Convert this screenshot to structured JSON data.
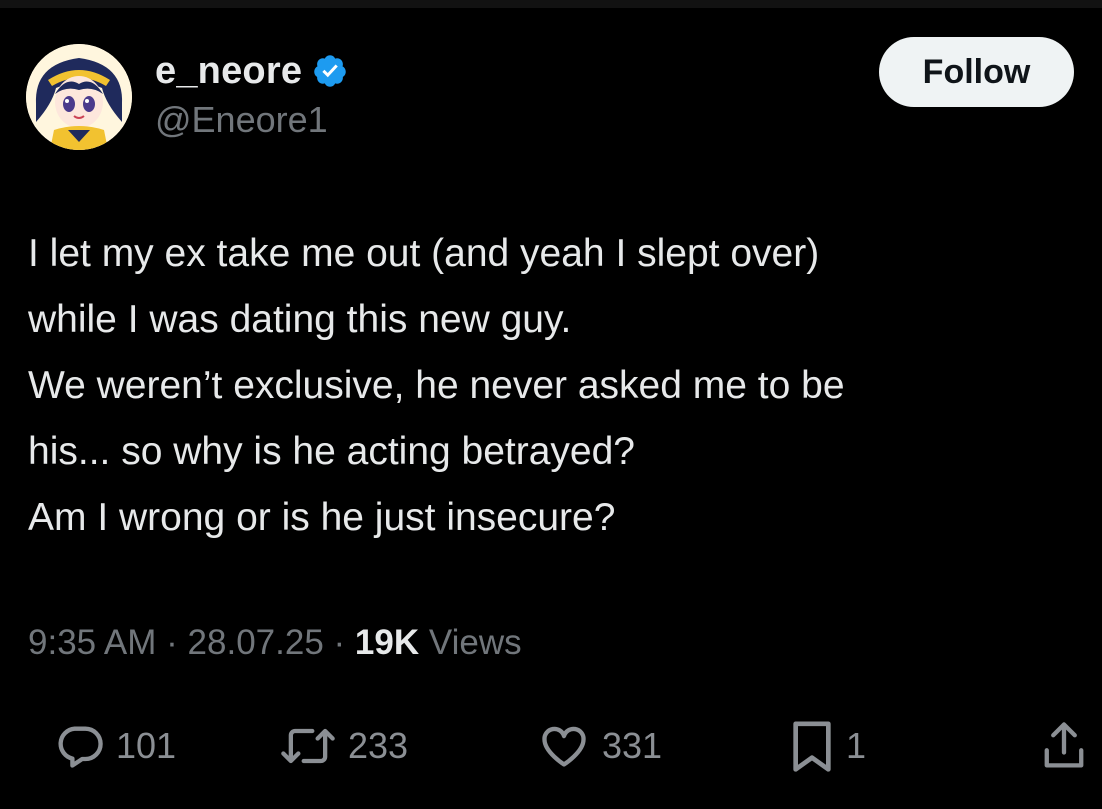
{
  "user": {
    "display_name": "e_neore",
    "handle": "@Eneore1",
    "verified": true
  },
  "follow_label": "Follow",
  "tweet": {
    "lines": [
      "I let my ex take me out (and yeah I slept over)",
      "while I was dating this new guy.",
      "We weren’t exclusive, he never asked me to be",
      "his... so why is he acting betrayed?",
      "Am I wrong or is he just insecure?"
    ]
  },
  "meta": {
    "time": "9:35 AM",
    "separator": "·",
    "date": "28.07.25",
    "views_count": "19K",
    "views_label": "Views"
  },
  "actions": {
    "replies": "101",
    "reposts": "233",
    "likes": "331",
    "bookmarks": "1"
  },
  "colors": {
    "background": "#000000",
    "text": "#e7e9ea",
    "muted": "#71767b",
    "verified": "#1d9bf0",
    "follow_bg": "#eff3f4"
  },
  "icons": {
    "verified": "verified-badge-icon",
    "reply": "reply-bubble-icon",
    "repost": "repost-arrows-icon",
    "like": "heart-icon",
    "bookmark": "bookmark-icon",
    "share": "share-upload-icon"
  }
}
